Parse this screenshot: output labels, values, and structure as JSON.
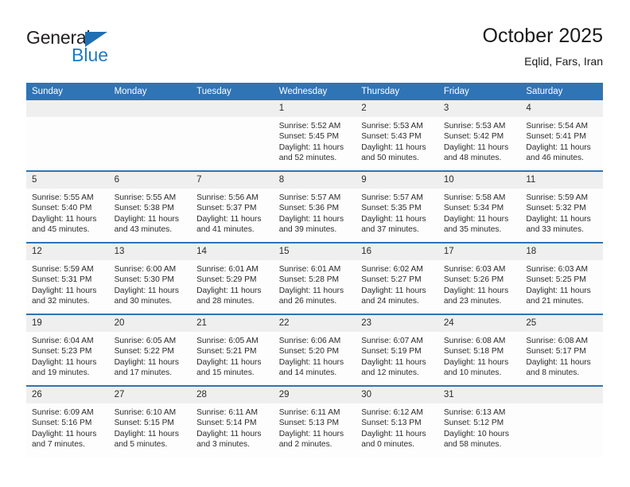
{
  "brand": {
    "name_part1": "General",
    "name_part2": "Blue",
    "triangle_icon": "triangle-icon",
    "accent_color": "#1f7ac4"
  },
  "header": {
    "title": "October 2025",
    "subtitle": "Eqlid, Fars, Iran"
  },
  "calendar": {
    "header_color": "#2f74b5",
    "daynum_band_color": "#efefef",
    "weekdays": [
      "Sunday",
      "Monday",
      "Tuesday",
      "Wednesday",
      "Thursday",
      "Friday",
      "Saturday"
    ],
    "weeks": [
      [
        {
          "day": "",
          "empty": true,
          "sunrise": "",
          "sunset": "",
          "daylight_line1": "",
          "daylight_line2": ""
        },
        {
          "day": "",
          "empty": true,
          "sunrise": "",
          "sunset": "",
          "daylight_line1": "",
          "daylight_line2": ""
        },
        {
          "day": "",
          "empty": true,
          "sunrise": "",
          "sunset": "",
          "daylight_line1": "",
          "daylight_line2": ""
        },
        {
          "day": "1",
          "empty": false,
          "sunrise": "Sunrise: 5:52 AM",
          "sunset": "Sunset: 5:45 PM",
          "daylight_line1": "Daylight: 11 hours",
          "daylight_line2": "and 52 minutes."
        },
        {
          "day": "2",
          "empty": false,
          "sunrise": "Sunrise: 5:53 AM",
          "sunset": "Sunset: 5:43 PM",
          "daylight_line1": "Daylight: 11 hours",
          "daylight_line2": "and 50 minutes."
        },
        {
          "day": "3",
          "empty": false,
          "sunrise": "Sunrise: 5:53 AM",
          "sunset": "Sunset: 5:42 PM",
          "daylight_line1": "Daylight: 11 hours",
          "daylight_line2": "and 48 minutes."
        },
        {
          "day": "4",
          "empty": false,
          "sunrise": "Sunrise: 5:54 AM",
          "sunset": "Sunset: 5:41 PM",
          "daylight_line1": "Daylight: 11 hours",
          "daylight_line2": "and 46 minutes."
        }
      ],
      [
        {
          "day": "5",
          "empty": false,
          "sunrise": "Sunrise: 5:55 AM",
          "sunset": "Sunset: 5:40 PM",
          "daylight_line1": "Daylight: 11 hours",
          "daylight_line2": "and 45 minutes."
        },
        {
          "day": "6",
          "empty": false,
          "sunrise": "Sunrise: 5:55 AM",
          "sunset": "Sunset: 5:38 PM",
          "daylight_line1": "Daylight: 11 hours",
          "daylight_line2": "and 43 minutes."
        },
        {
          "day": "7",
          "empty": false,
          "sunrise": "Sunrise: 5:56 AM",
          "sunset": "Sunset: 5:37 PM",
          "daylight_line1": "Daylight: 11 hours",
          "daylight_line2": "and 41 minutes."
        },
        {
          "day": "8",
          "empty": false,
          "sunrise": "Sunrise: 5:57 AM",
          "sunset": "Sunset: 5:36 PM",
          "daylight_line1": "Daylight: 11 hours",
          "daylight_line2": "and 39 minutes."
        },
        {
          "day": "9",
          "empty": false,
          "sunrise": "Sunrise: 5:57 AM",
          "sunset": "Sunset: 5:35 PM",
          "daylight_line1": "Daylight: 11 hours",
          "daylight_line2": "and 37 minutes."
        },
        {
          "day": "10",
          "empty": false,
          "sunrise": "Sunrise: 5:58 AM",
          "sunset": "Sunset: 5:34 PM",
          "daylight_line1": "Daylight: 11 hours",
          "daylight_line2": "and 35 minutes."
        },
        {
          "day": "11",
          "empty": false,
          "sunrise": "Sunrise: 5:59 AM",
          "sunset": "Sunset: 5:32 PM",
          "daylight_line1": "Daylight: 11 hours",
          "daylight_line2": "and 33 minutes."
        }
      ],
      [
        {
          "day": "12",
          "empty": false,
          "sunrise": "Sunrise: 5:59 AM",
          "sunset": "Sunset: 5:31 PM",
          "daylight_line1": "Daylight: 11 hours",
          "daylight_line2": "and 32 minutes."
        },
        {
          "day": "13",
          "empty": false,
          "sunrise": "Sunrise: 6:00 AM",
          "sunset": "Sunset: 5:30 PM",
          "daylight_line1": "Daylight: 11 hours",
          "daylight_line2": "and 30 minutes."
        },
        {
          "day": "14",
          "empty": false,
          "sunrise": "Sunrise: 6:01 AM",
          "sunset": "Sunset: 5:29 PM",
          "daylight_line1": "Daylight: 11 hours",
          "daylight_line2": "and 28 minutes."
        },
        {
          "day": "15",
          "empty": false,
          "sunrise": "Sunrise: 6:01 AM",
          "sunset": "Sunset: 5:28 PM",
          "daylight_line1": "Daylight: 11 hours",
          "daylight_line2": "and 26 minutes."
        },
        {
          "day": "16",
          "empty": false,
          "sunrise": "Sunrise: 6:02 AM",
          "sunset": "Sunset: 5:27 PM",
          "daylight_line1": "Daylight: 11 hours",
          "daylight_line2": "and 24 minutes."
        },
        {
          "day": "17",
          "empty": false,
          "sunrise": "Sunrise: 6:03 AM",
          "sunset": "Sunset: 5:26 PM",
          "daylight_line1": "Daylight: 11 hours",
          "daylight_line2": "and 23 minutes."
        },
        {
          "day": "18",
          "empty": false,
          "sunrise": "Sunrise: 6:03 AM",
          "sunset": "Sunset: 5:25 PM",
          "daylight_line1": "Daylight: 11 hours",
          "daylight_line2": "and 21 minutes."
        }
      ],
      [
        {
          "day": "19",
          "empty": false,
          "sunrise": "Sunrise: 6:04 AM",
          "sunset": "Sunset: 5:23 PM",
          "daylight_line1": "Daylight: 11 hours",
          "daylight_line2": "and 19 minutes."
        },
        {
          "day": "20",
          "empty": false,
          "sunrise": "Sunrise: 6:05 AM",
          "sunset": "Sunset: 5:22 PM",
          "daylight_line1": "Daylight: 11 hours",
          "daylight_line2": "and 17 minutes."
        },
        {
          "day": "21",
          "empty": false,
          "sunrise": "Sunrise: 6:05 AM",
          "sunset": "Sunset: 5:21 PM",
          "daylight_line1": "Daylight: 11 hours",
          "daylight_line2": "and 15 minutes."
        },
        {
          "day": "22",
          "empty": false,
          "sunrise": "Sunrise: 6:06 AM",
          "sunset": "Sunset: 5:20 PM",
          "daylight_line1": "Daylight: 11 hours",
          "daylight_line2": "and 14 minutes."
        },
        {
          "day": "23",
          "empty": false,
          "sunrise": "Sunrise: 6:07 AM",
          "sunset": "Sunset: 5:19 PM",
          "daylight_line1": "Daylight: 11 hours",
          "daylight_line2": "and 12 minutes."
        },
        {
          "day": "24",
          "empty": false,
          "sunrise": "Sunrise: 6:08 AM",
          "sunset": "Sunset: 5:18 PM",
          "daylight_line1": "Daylight: 11 hours",
          "daylight_line2": "and 10 minutes."
        },
        {
          "day": "25",
          "empty": false,
          "sunrise": "Sunrise: 6:08 AM",
          "sunset": "Sunset: 5:17 PM",
          "daylight_line1": "Daylight: 11 hours",
          "daylight_line2": "and 8 minutes."
        }
      ],
      [
        {
          "day": "26",
          "empty": false,
          "sunrise": "Sunrise: 6:09 AM",
          "sunset": "Sunset: 5:16 PM",
          "daylight_line1": "Daylight: 11 hours",
          "daylight_line2": "and 7 minutes."
        },
        {
          "day": "27",
          "empty": false,
          "sunrise": "Sunrise: 6:10 AM",
          "sunset": "Sunset: 5:15 PM",
          "daylight_line1": "Daylight: 11 hours",
          "daylight_line2": "and 5 minutes."
        },
        {
          "day": "28",
          "empty": false,
          "sunrise": "Sunrise: 6:11 AM",
          "sunset": "Sunset: 5:14 PM",
          "daylight_line1": "Daylight: 11 hours",
          "daylight_line2": "and 3 minutes."
        },
        {
          "day": "29",
          "empty": false,
          "sunrise": "Sunrise: 6:11 AM",
          "sunset": "Sunset: 5:13 PM",
          "daylight_line1": "Daylight: 11 hours",
          "daylight_line2": "and 2 minutes."
        },
        {
          "day": "30",
          "empty": false,
          "sunrise": "Sunrise: 6:12 AM",
          "sunset": "Sunset: 5:13 PM",
          "daylight_line1": "Daylight: 11 hours",
          "daylight_line2": "and 0 minutes."
        },
        {
          "day": "31",
          "empty": false,
          "sunrise": "Sunrise: 6:13 AM",
          "sunset": "Sunset: 5:12 PM",
          "daylight_line1": "Daylight: 10 hours",
          "daylight_line2": "and 58 minutes."
        },
        {
          "day": "",
          "empty": true,
          "sunrise": "",
          "sunset": "",
          "daylight_line1": "",
          "daylight_line2": ""
        }
      ]
    ]
  }
}
